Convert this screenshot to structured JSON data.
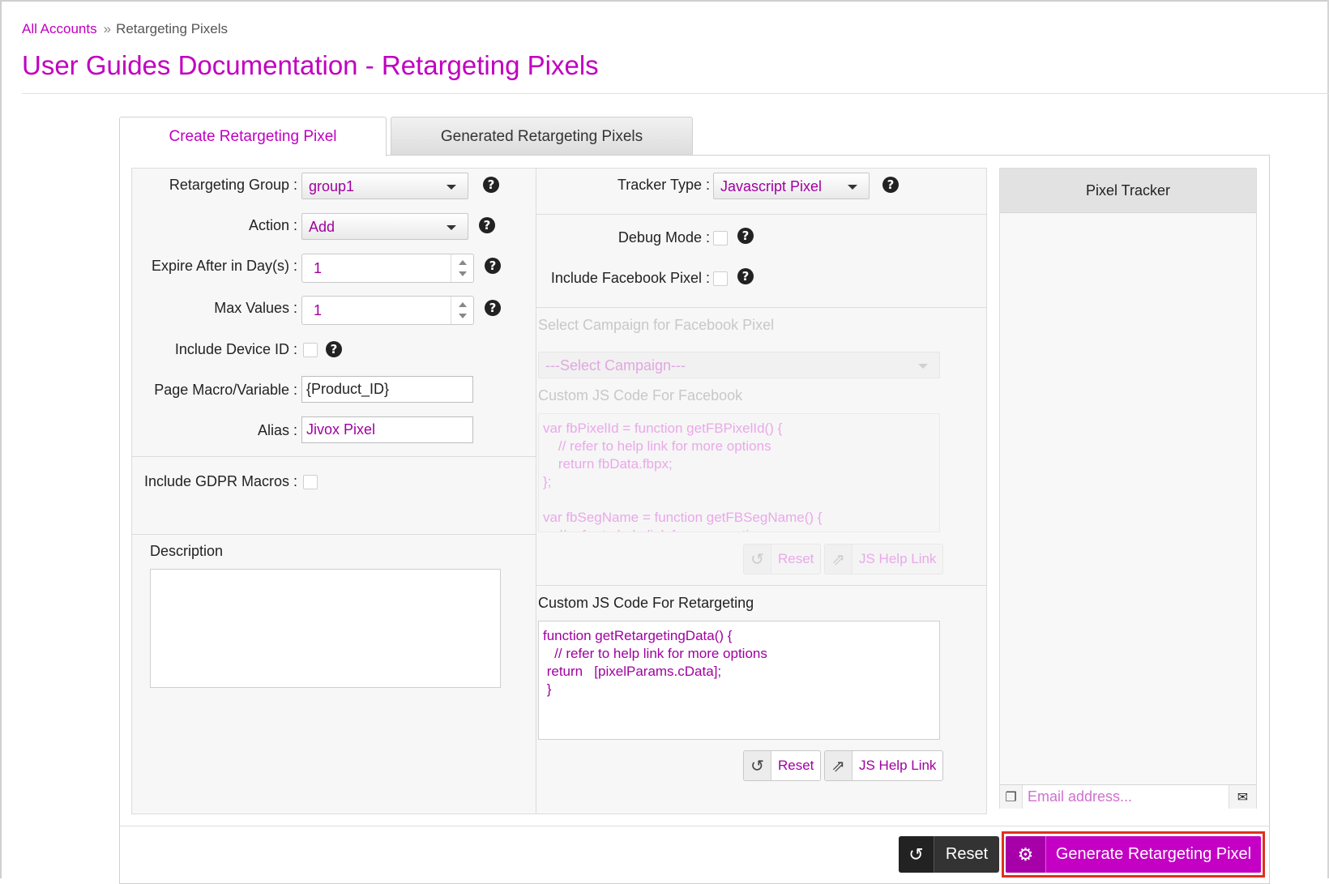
{
  "breadcrumb": {
    "root": "All Accounts",
    "separator": "»",
    "current": "Retargeting Pixels"
  },
  "page": {
    "title": "User Guides Documentation - Retargeting Pixels"
  },
  "tabs": [
    {
      "label": "Create Retargeting Pixel",
      "active": true
    },
    {
      "label": "Generated Retargeting Pixels",
      "active": false
    }
  ],
  "form": {
    "retargeting_group": {
      "label": "Retargeting Group :",
      "value": "group1"
    },
    "action": {
      "label": "Action :",
      "value": "Add"
    },
    "expire": {
      "label": "Expire After in Day(s) :",
      "value": "1"
    },
    "max_values": {
      "label": "Max Values :",
      "value": "1"
    },
    "device_id": {
      "label": "Include Device ID :"
    },
    "page_macro": {
      "label": "Page Macro/Variable :",
      "value": "{Product_ID}"
    },
    "alias": {
      "label": "Alias :",
      "value": "Jivox Pixel"
    },
    "gdpr": {
      "label": "Include GDPR Macros :"
    },
    "description": {
      "label": "Description",
      "value": ""
    }
  },
  "tracker": {
    "type_label": "Tracker Type :",
    "type_value": "Javascript Pixel",
    "debug_label": "Debug Mode :",
    "facebook_label": "Include Facebook Pixel :",
    "campaign_label": "Select Campaign for Facebook Pixel",
    "campaign_placeholder": "---Select Campaign---",
    "fb_code_label": "Custom JS Code For Facebook",
    "fb_code": "var fbPixelId = function getFBPixelId() {\n    // refer to help link for more options\n    return fbData.fbpx;\n};\n\nvar fbSegName = function getFBSegName() {\n    // refer to help link for more options",
    "retarget_code_label": "Custom JS Code For Retargeting",
    "retarget_code": "function getRetargetingData() {\n   // refer to help link for more options\n return   [pixelParams.cData];\n }",
    "reset_label": "Reset",
    "help_link_label": "JS Help Link"
  },
  "pixel_tracker": {
    "title": "Pixel Tracker",
    "email_placeholder": "Email address..."
  },
  "footer": {
    "reset_label": "Reset",
    "generate_label": "Generate Retargeting Pixel"
  },
  "colors": {
    "accent": "#c000c0",
    "highlight": "#e0301e"
  }
}
